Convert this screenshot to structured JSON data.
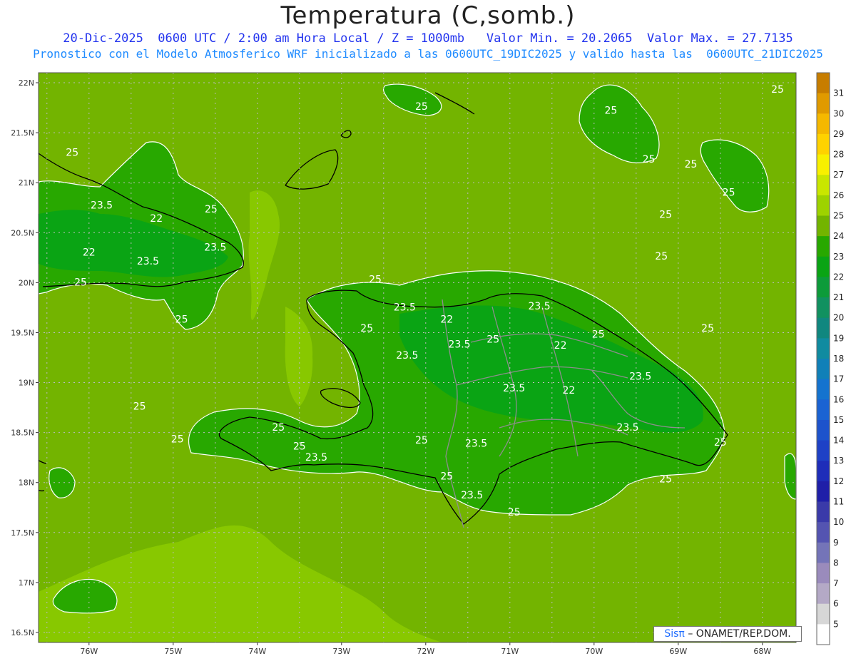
{
  "title": "Temperatura (C,somb.)",
  "subtitle_1": "20-Dic-2025  0600 UTC / 2:00 am Hora Local / Z = 1000mb   Valor Min. = 20.2065  Valor Max. = 27.7135",
  "subtitle_2": "Pronostico con el Modelo Atmosferico WRF inicializado a las 0600UTC_19DIC2025 y valido hasta las  0600UTC_21DIC2025",
  "credit": {
    "brand": "Sisπ",
    "text": "– ONAMET/REP.DOM."
  },
  "map": {
    "lat_labels": [
      "22N",
      "21.5N",
      "21N",
      "20.5N",
      "20N",
      "19.5N",
      "19N",
      "18.5N",
      "18N",
      "17.5N",
      "17N",
      "16.5N"
    ],
    "lon_labels": [
      "76W",
      "75W",
      "74W",
      "73W",
      "72W",
      "71W",
      "70W",
      "69W",
      "68W"
    ],
    "lat_range": [
      16.4,
      22.1
    ],
    "lon_range": [
      -76.6,
      -67.6
    ],
    "contour_labels": [
      {
        "text": "25",
        "lon": -76.2,
        "lat": 21.27
      },
      {
        "text": "23.5",
        "lon": -75.85,
        "lat": 20.74
      },
      {
        "text": "22",
        "lon": -75.2,
        "lat": 20.61
      },
      {
        "text": "22",
        "lon": -76.0,
        "lat": 20.27
      },
      {
        "text": "23.5",
        "lon": -74.5,
        "lat": 20.32
      },
      {
        "text": "23.5",
        "lon": -75.3,
        "lat": 20.18
      },
      {
        "text": "25",
        "lon": -74.55,
        "lat": 20.7
      },
      {
        "text": "25",
        "lon": -76.1,
        "lat": 19.97
      },
      {
        "text": "25",
        "lon": -74.9,
        "lat": 19.6
      },
      {
        "text": "25",
        "lon": -72.6,
        "lat": 20.0
      },
      {
        "text": "23.5",
        "lon": -72.25,
        "lat": 19.72
      },
      {
        "text": "22",
        "lon": -71.75,
        "lat": 19.6
      },
      {
        "text": "25",
        "lon": -72.7,
        "lat": 19.51
      },
      {
        "text": "23.5",
        "lon": -71.6,
        "lat": 19.35
      },
      {
        "text": "23.5",
        "lon": -72.22,
        "lat": 19.24
      },
      {
        "text": "25",
        "lon": -71.2,
        "lat": 19.4
      },
      {
        "text": "23.5",
        "lon": -70.65,
        "lat": 19.73
      },
      {
        "text": "22",
        "lon": -70.4,
        "lat": 19.34
      },
      {
        "text": "25",
        "lon": -69.95,
        "lat": 19.45
      },
      {
        "text": "23.5",
        "lon": -69.45,
        "lat": 19.03
      },
      {
        "text": "23.5",
        "lon": -70.95,
        "lat": 18.91
      },
      {
        "text": "22",
        "lon": -70.3,
        "lat": 18.89
      },
      {
        "text": "23.5",
        "lon": -69.6,
        "lat": 18.52
      },
      {
        "text": "25",
        "lon": -68.5,
        "lat": 18.37
      },
      {
        "text": "25",
        "lon": -75.4,
        "lat": 18.73
      },
      {
        "text": "25",
        "lon": -73.75,
        "lat": 18.52
      },
      {
        "text": "25",
        "lon": -74.95,
        "lat": 18.4
      },
      {
        "text": "25",
        "lon": -73.5,
        "lat": 18.33
      },
      {
        "text": "23.5",
        "lon": -73.3,
        "lat": 18.22
      },
      {
        "text": "25",
        "lon": -72.05,
        "lat": 18.39
      },
      {
        "text": "23.5",
        "lon": -71.4,
        "lat": 18.36
      },
      {
        "text": "25",
        "lon": -71.75,
        "lat": 18.03
      },
      {
        "text": "23.5",
        "lon": -71.45,
        "lat": 17.84
      },
      {
        "text": "25",
        "lon": -70.95,
        "lat": 17.67
      },
      {
        "text": "25",
        "lon": -69.15,
        "lat": 18.0
      },
      {
        "text": "25",
        "lon": -72.05,
        "lat": 21.73
      },
      {
        "text": "25",
        "lon": -69.8,
        "lat": 21.69
      },
      {
        "text": "25",
        "lon": -69.35,
        "lat": 21.2
      },
      {
        "text": "25",
        "lon": -68.85,
        "lat": 21.15
      },
      {
        "text": "25",
        "lon": -68.4,
        "lat": 20.87
      },
      {
        "text": "25",
        "lon": -67.82,
        "lat": 21.9
      },
      {
        "text": "25",
        "lon": -67.38,
        "lat": 20.98
      },
      {
        "text": "25",
        "lon": -69.15,
        "lat": 20.65
      },
      {
        "text": "25",
        "lon": -69.2,
        "lat": 20.23
      },
      {
        "text": "25",
        "lon": -68.65,
        "lat": 19.51
      }
    ]
  },
  "colorbar": {
    "labels": [
      "31",
      "30",
      "29",
      "28",
      "27",
      "26",
      "25",
      "24",
      "23",
      "22",
      "21",
      "20",
      "19",
      "18",
      "17",
      "16",
      "15",
      "14",
      "13",
      "12",
      "11",
      "10",
      "9",
      "8",
      "7",
      "6",
      "5"
    ],
    "colors": [
      "#c77d00",
      "#e09a00",
      "#f5b800",
      "#ffd200",
      "#f8f000",
      "#c9e600",
      "#9ed200",
      "#73b400",
      "#28a800",
      "#0aa414",
      "#0d9b3a",
      "#119160",
      "#10877f",
      "#108ba0",
      "#1080b8",
      "#1473cf",
      "#1a63d3",
      "#1d53cc",
      "#1e41c6",
      "#1e2db9",
      "#1f1fa8",
      "#3a3aa9",
      "#5454b1",
      "#7474b8",
      "#9a8bbc",
      "#b4a9c6",
      "#d7d7d7",
      "#ffffff"
    ]
  }
}
